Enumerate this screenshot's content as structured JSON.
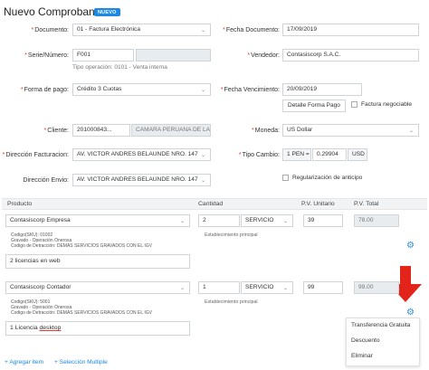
{
  "header": {
    "title": "Nuevo Comprobante",
    "badge": "NUEVO"
  },
  "form": {
    "documento": {
      "label": "Documento:",
      "value": "01 - Factura Electrónica"
    },
    "fecha_documento": {
      "label": "Fecha Documento:",
      "value": "17/09/2019"
    },
    "serie": {
      "label": "Serie/Número:",
      "value": "F001",
      "numero": ""
    },
    "tipo_operacion": "Tipo operación: 0101 - Venta interna",
    "vendedor": {
      "label": "Vendedor:",
      "value": "Contasiscorp S.A.C."
    },
    "forma_pago": {
      "label": "Forma de pago:",
      "value": "Crédito 3 Cuotas"
    },
    "fecha_vencimiento": {
      "label": "Fecha Vencimiento:",
      "value": "20/09/2019"
    },
    "detalle_forma_pago": "Detalle Forma Pago",
    "factura_negociable": "Factura negociable",
    "cliente": {
      "label": "Cliente:",
      "code": "201000843...",
      "name": "CAMARA PERUANA DE LA"
    },
    "moneda": {
      "label": "Moneda:",
      "value": "US Dollar"
    },
    "direccion_facturacion": {
      "label": "Dirección Facturacion:",
      "value": "AV. VICTOR ANDRES BELAUNDE NRO. 147"
    },
    "tipo_cambio": {
      "label": "Tipo Cambio:",
      "prefix": "1 PEN =",
      "value": "0.29904",
      "currency": "USD"
    },
    "direccion_envio": {
      "label": "Dirección Envio:",
      "value": "AV. VICTOR ANDRES BELAUNDE NRO. 147"
    },
    "regularizacion": "Regularización de anticipo"
  },
  "table": {
    "headers": [
      "Producto",
      "Cantidad",
      "P.V. Unitario",
      "P.V. Total"
    ],
    "rows": [
      {
        "producto": "Contasiscorp Empresa",
        "codigo": "Codigo(SKU): 01002",
        "gravado": "Gravado - Operación Onerosa",
        "detraccion": "Codigo de Detracción: DEMÁS SERVICIOS GRAVADOS CON EL IGV",
        "cantidad": "2",
        "unidad": "SERVICIO",
        "establecimiento": "Establecimiento principal",
        "unitario": "39",
        "total": "78.00",
        "descripcion": "2 licencias en web"
      },
      {
        "producto": "Contasiscorp Contador",
        "codigo": "Codigo(SKU): 5001",
        "gravado": "Gravado - Operación Onerosa",
        "detraccion": "Codigo de Detracción: DEMÁS SERVICIOS GRAVADOS CON EL IGV",
        "cantidad": "1",
        "unidad": "SERVICIO",
        "establecimiento": "Establecimiento principal",
        "unitario": "99",
        "total": "99.00",
        "descripcion_a": "1 Licencia",
        "descripcion_b": "desktop"
      }
    ]
  },
  "context_menu": [
    "Transferencia Gratuita",
    "Descuento",
    "Eliminar"
  ],
  "footer": {
    "agregar": "+ Agregar item",
    "seleccion": "+ Selección Multiple"
  },
  "colors": {
    "accent": "#1e88e5",
    "arrow": "#e3241b",
    "required": "#e53935"
  },
  "icons": {
    "row_settings": "gear-icon",
    "annotation": "red-down-arrow"
  }
}
